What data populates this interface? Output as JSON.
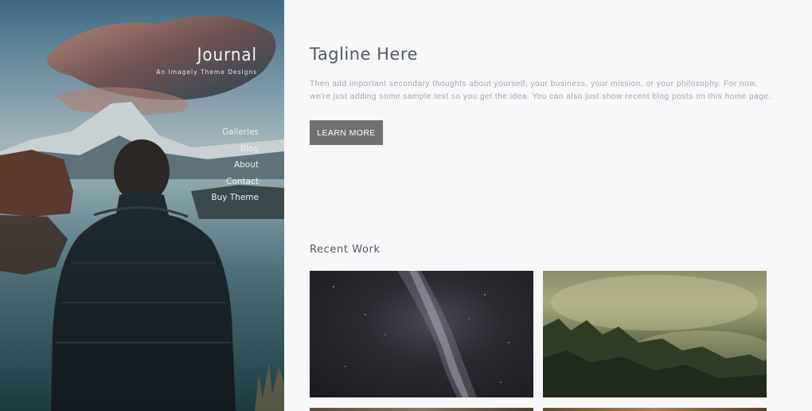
{
  "site": {
    "title": "Journal",
    "tagline": "An Imagely Theme Designs"
  },
  "nav": {
    "items": [
      {
        "label": "Galleries"
      },
      {
        "label": "Blog"
      },
      {
        "label": "About"
      },
      {
        "label": "Contact"
      },
      {
        "label": "Buy Theme"
      }
    ]
  },
  "main": {
    "heading": "Tagline Here",
    "intro": "Then add important secondary thoughts about yourself, your business, your mission, or your philosophy. For now, we're just adding some sample text so you get the idea. You can also just show recent blog posts on this home page.",
    "cta_label": "LEARN MORE",
    "recent_work_title": "Recent Work"
  },
  "colors": {
    "button_bg": "#707070",
    "heading_text": "#555a5e",
    "body_text": "#a2a7ab",
    "page_bg": "#f6f7f9"
  }
}
